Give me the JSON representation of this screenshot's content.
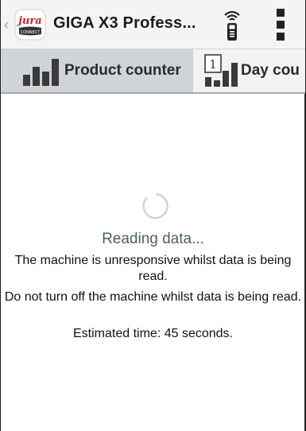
{
  "appbar": {
    "title": "GIGA X3 Profess...",
    "logo": {
      "brand_text": "jura",
      "badge_text": "CONNECT",
      "brand_color": "#d21f26"
    },
    "icons": {
      "back": "chevron-left-icon",
      "remote": "remote-control-icon",
      "overflow": "overflow-menu-icon"
    }
  },
  "tabs": [
    {
      "label": "Product counter",
      "icon": "bar-chart-icon",
      "active": true
    },
    {
      "label": "Day cou",
      "icon": "calendar-bar-chart-icon",
      "active": false
    }
  ],
  "status": {
    "title": "Reading data...",
    "message_1": "The machine is unresponsive whilst data is being read.",
    "message_2": "Do not turn off the machine whilst data is being read.",
    "message_3": "Estimated time: 45 seconds."
  },
  "colors": {
    "accent_dark": "#2a2a2a",
    "tab_active_bg": "#cfd4d9",
    "status_title": "#4d5d6d"
  }
}
